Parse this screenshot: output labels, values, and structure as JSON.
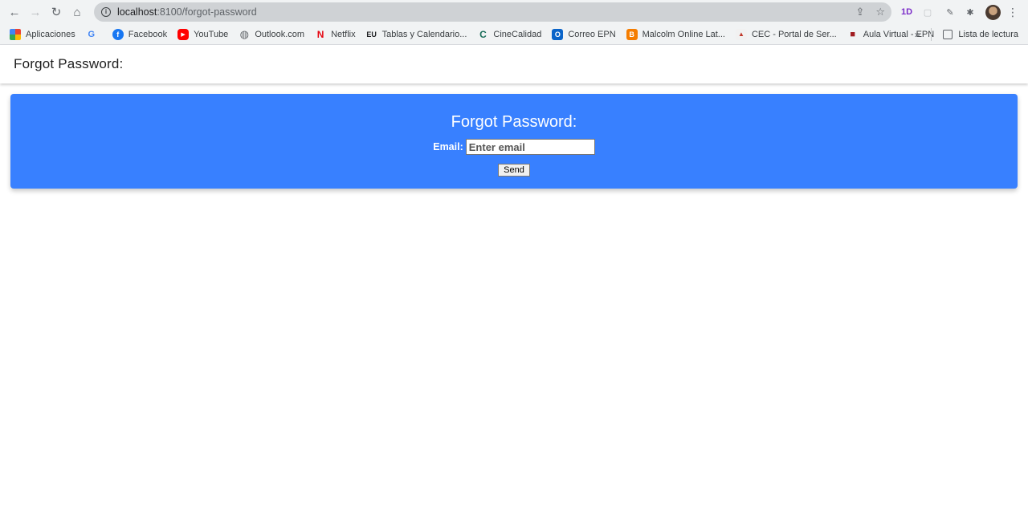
{
  "browser": {
    "url_host": "localhost",
    "url_path": ":8100/forgot-password",
    "extension_label": "1D",
    "bookmarks": [
      {
        "label": "Aplicaciones",
        "icon": "apps-grid-icon"
      },
      {
        "label": "",
        "icon": "google-icon",
        "glyph": "G"
      },
      {
        "label": "Facebook",
        "icon": "facebook-icon",
        "glyph": "f"
      },
      {
        "label": "YouTube",
        "icon": "youtube-icon",
        "glyph": "▶"
      },
      {
        "label": "Outlook.com",
        "icon": "globe-icon",
        "glyph": "◍"
      },
      {
        "label": "Netflix",
        "icon": "netflix-icon",
        "glyph": "N"
      },
      {
        "label": "Tablas y Calendario...",
        "icon": "eu-icon",
        "glyph": "EU"
      },
      {
        "label": "CineCalidad",
        "icon": "cinecalidad-icon",
        "glyph": "C"
      },
      {
        "label": "Correo EPN",
        "icon": "outlook-icon",
        "glyph": "O"
      },
      {
        "label": "Malcolm Online Lat...",
        "icon": "blogger-icon",
        "glyph": "B"
      },
      {
        "label": "CEC - Portal de Ser...",
        "icon": "cec-icon",
        "glyph": "▲"
      },
      {
        "label": "Aula Virtual - EPN",
        "icon": "epn-icon",
        "glyph": "■"
      }
    ],
    "more_label": "»",
    "reading_list_label": "Lista de lectura"
  },
  "header": {
    "title": "Forgot Password:"
  },
  "card": {
    "title": "Forgot Password:",
    "email_label": "Email:",
    "email_placeholder": "Enter email",
    "email_value": "",
    "send_label": "Send"
  },
  "colors": {
    "card_background": "#3880ff",
    "card_text": "#ffffff"
  }
}
